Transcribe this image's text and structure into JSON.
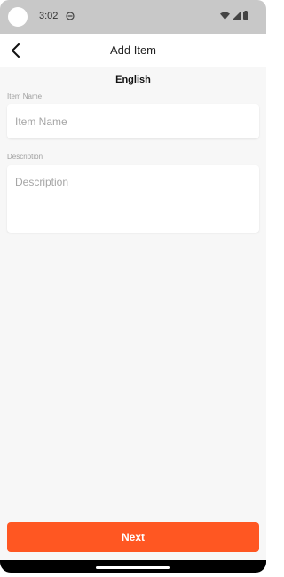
{
  "status_bar": {
    "time": "3:02",
    "icons": [
      "camera-cutout",
      "notification-icon",
      "wifi-icon",
      "signal-icon",
      "battery-icon"
    ]
  },
  "app_bar": {
    "title": "Add Item",
    "back_icon": "back-arrow-icon"
  },
  "form": {
    "language": "English",
    "item_name": {
      "label": "Item Name",
      "placeholder": "Item Name",
      "value": ""
    },
    "description": {
      "label": "Description",
      "placeholder": "Description",
      "value": ""
    }
  },
  "actions": {
    "next_label": "Next"
  },
  "colors": {
    "status_bar_bg": "#c8c8c8",
    "content_bg": "#f7f7f7",
    "accent": "#ff5722",
    "label_gray": "#9e9e9e"
  }
}
